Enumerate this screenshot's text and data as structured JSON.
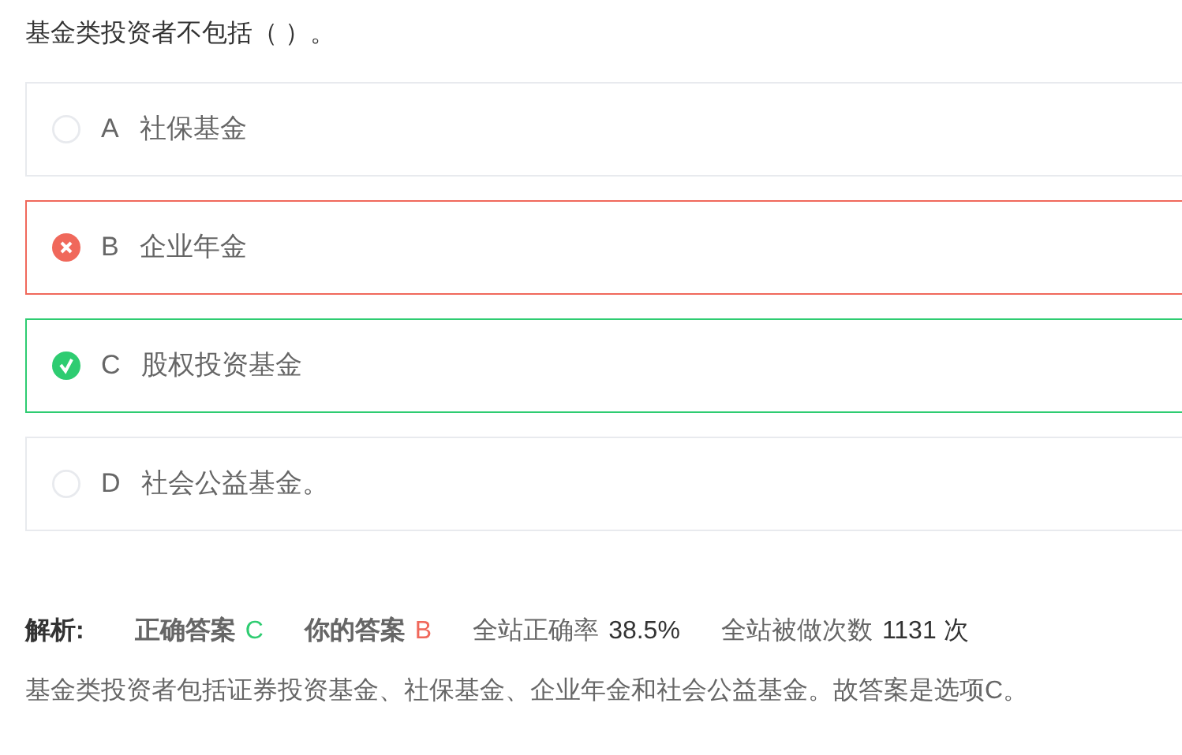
{
  "question": "基金类投资者不包括（ ）。",
  "options": [
    {
      "letter": "A",
      "text": "社保基金",
      "kind": "neutral"
    },
    {
      "letter": "B",
      "text": "企业年金",
      "kind": "wrong"
    },
    {
      "letter": "C",
      "text": "股权投资基金",
      "kind": "correct"
    },
    {
      "letter": "D",
      "text": "社会公益基金。",
      "kind": "neutral"
    }
  ],
  "analysis": {
    "label": "解析:",
    "correct_label": "正确答案",
    "correct_answer": "C",
    "your_label": "你的答案",
    "your_answer": "B",
    "stats": [
      {
        "label": "全站正确率",
        "value": "38.5%"
      },
      {
        "label": "全站被做次数",
        "value": "1131 次"
      }
    ],
    "explanation": "基金类投资者包括证券投资基金、社保基金、企业年金和社会公益基金。故答案是选项C。"
  }
}
